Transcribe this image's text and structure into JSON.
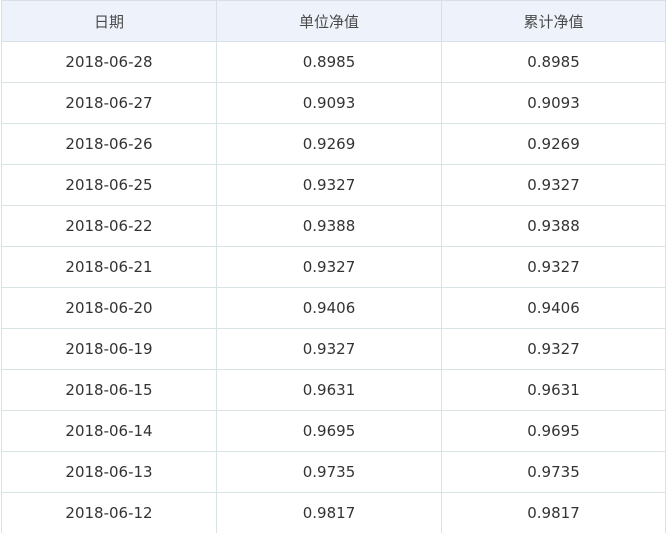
{
  "table": {
    "headers": [
      "日期",
      "单位净值",
      "累计净值"
    ],
    "rows": [
      [
        "2018-06-28",
        "0.8985",
        "0.8985"
      ],
      [
        "2018-06-27",
        "0.9093",
        "0.9093"
      ],
      [
        "2018-06-26",
        "0.9269",
        "0.9269"
      ],
      [
        "2018-06-25",
        "0.9327",
        "0.9327"
      ],
      [
        "2018-06-22",
        "0.9388",
        "0.9388"
      ],
      [
        "2018-06-21",
        "0.9327",
        "0.9327"
      ],
      [
        "2018-06-20",
        "0.9406",
        "0.9406"
      ],
      [
        "2018-06-19",
        "0.9327",
        "0.9327"
      ],
      [
        "2018-06-15",
        "0.9631",
        "0.9631"
      ],
      [
        "2018-06-14",
        "0.9695",
        "0.9695"
      ],
      [
        "2018-06-13",
        "0.9735",
        "0.9735"
      ],
      [
        "2018-06-12",
        "0.9817",
        "0.9817"
      ]
    ]
  }
}
